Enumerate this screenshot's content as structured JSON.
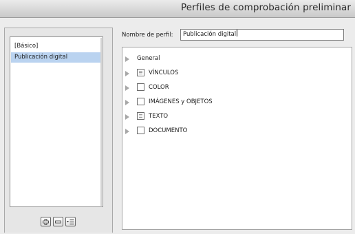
{
  "window": {
    "title": "Perfiles de comprobación preliminar"
  },
  "profiles": {
    "items": [
      {
        "label": "[Básico]",
        "selected": false
      },
      {
        "label": "Publicación digital",
        "selected": true
      }
    ]
  },
  "buttons": {
    "new_icon": "new-profile-icon",
    "delete_icon": "delete-profile-icon",
    "menu_icon": "profile-menu-icon"
  },
  "profile_name": {
    "label": "Nombre de perfil:",
    "value": "Publicación digital"
  },
  "tree": {
    "items": [
      {
        "label": "General",
        "checkbox": "none"
      },
      {
        "label": "VÍNCULOS",
        "checkbox": "mixed"
      },
      {
        "label": "COLOR",
        "checkbox": "unchecked"
      },
      {
        "label": "IMÁGENES y OBJETOS",
        "checkbox": "unchecked"
      },
      {
        "label": "TEXTO",
        "checkbox": "mixed"
      },
      {
        "label": "DOCUMENTO",
        "checkbox": "unchecked"
      }
    ]
  }
}
